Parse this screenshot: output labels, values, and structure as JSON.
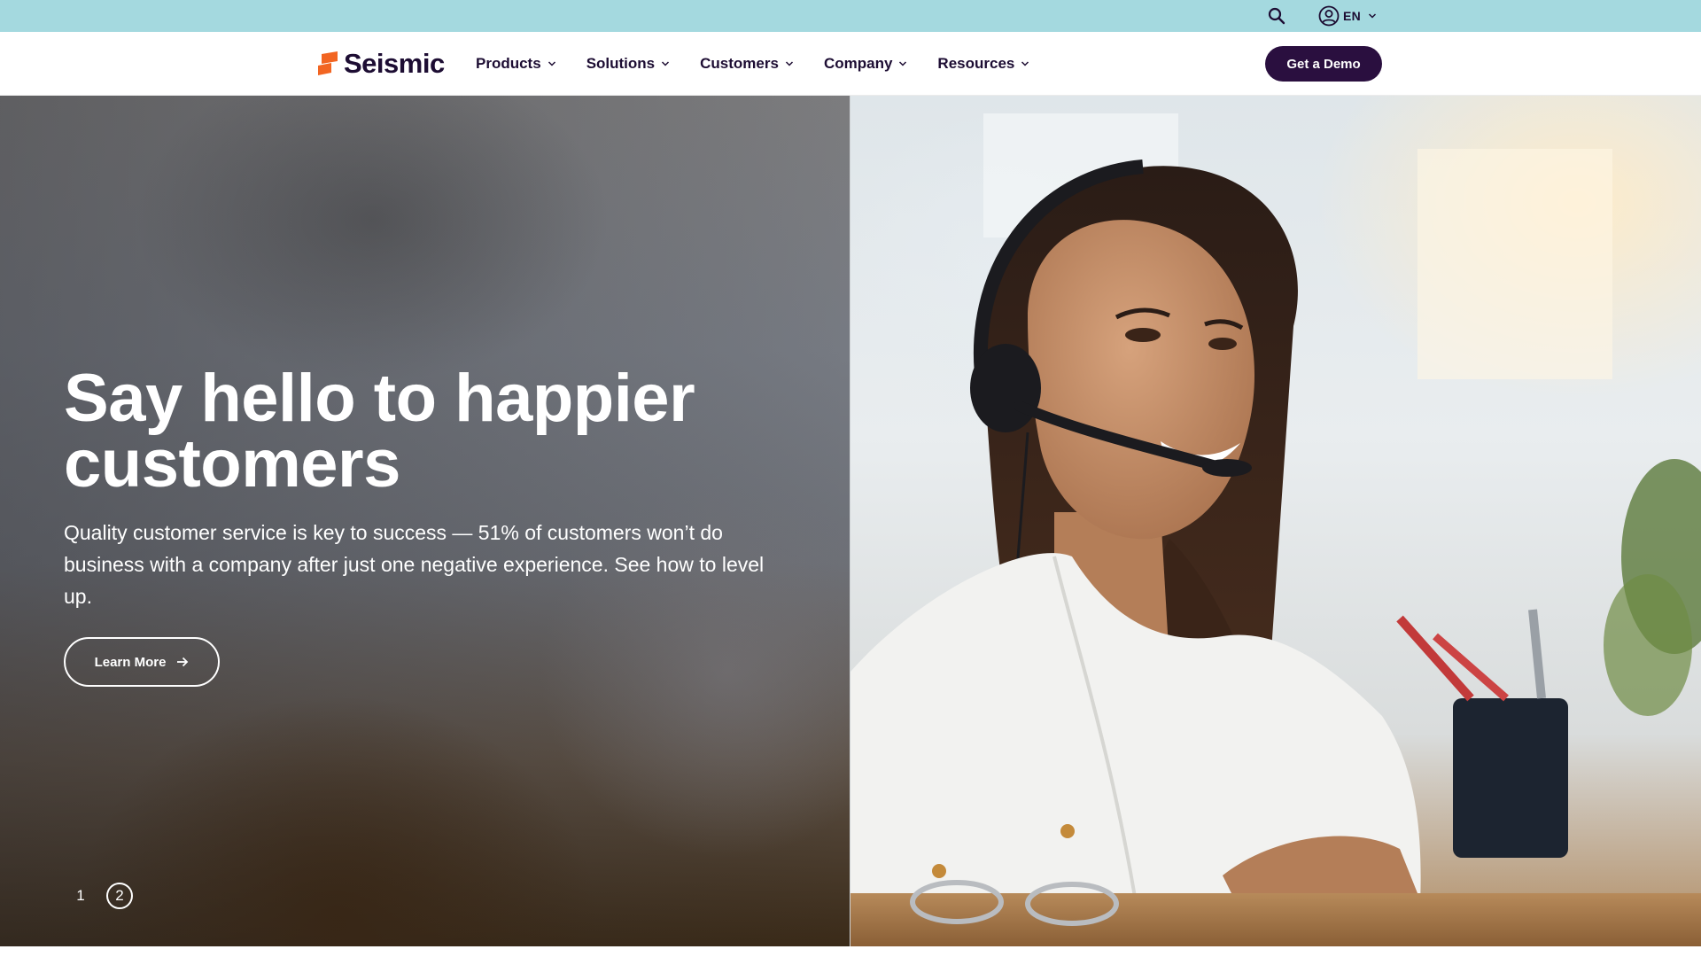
{
  "utility": {
    "language": "EN"
  },
  "nav": {
    "logo_text": "Seismic",
    "items": [
      {
        "label": "Products"
      },
      {
        "label": "Solutions"
      },
      {
        "label": "Customers"
      },
      {
        "label": "Company"
      },
      {
        "label": "Resources"
      }
    ],
    "cta_label": "Get a Demo"
  },
  "hero": {
    "title_line1": "Say hello to happier",
    "title_line2": "customers",
    "description": "Quality customer service is key to success — 51% of customers won’t do business with a company after just one negative experience. See how to level up.",
    "button_label": "Learn More",
    "pager": [
      "1",
      "2"
    ],
    "active_slide": 2
  },
  "colors": {
    "brand_orange": "#f26522",
    "brand_dark": "#1d0d33",
    "utility_bg": "#a4d9df",
    "cta_bg": "#2a0f3f"
  }
}
